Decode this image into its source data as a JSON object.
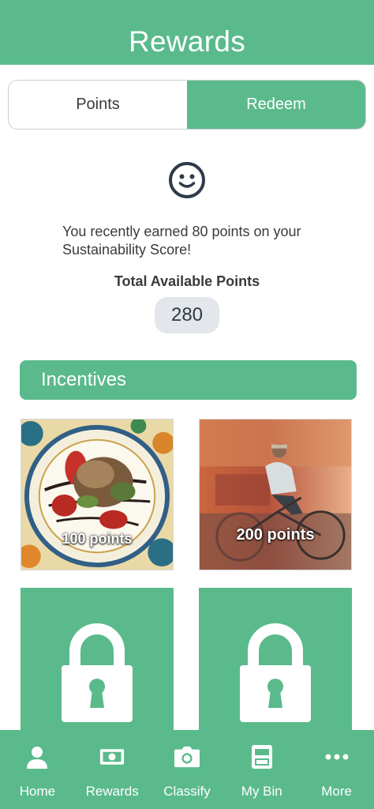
{
  "header": {
    "title": "Rewards"
  },
  "tabs": [
    {
      "label": "Points",
      "selected": false
    },
    {
      "label": "Redeem",
      "selected": true
    }
  ],
  "status_icon": "smiley-face-icon",
  "message": "You recently earned 80 points on your Sustainability Score!",
  "total": {
    "label": "Total Available Points",
    "value": "280"
  },
  "incentives": {
    "title": "Incentives",
    "cards": [
      {
        "label": "100 points",
        "image": "plated-food-photo",
        "locked": false
      },
      {
        "label": "200 points",
        "image": "cyclist-photo",
        "locked": false
      },
      {
        "label": "",
        "image": "lock-icon",
        "locked": true
      },
      {
        "label": "",
        "image": "lock-icon",
        "locked": true
      }
    ]
  },
  "bottom_nav": [
    {
      "label": "Home",
      "icon": "person-icon"
    },
    {
      "label": "Rewards",
      "icon": "cash-icon"
    },
    {
      "label": "Classify",
      "icon": "camera-icon"
    },
    {
      "label": "My Bin",
      "icon": "bin-icon"
    },
    {
      "label": "More",
      "icon": "more-dots-icon"
    }
  ],
  "colors": {
    "accent": "#5aba8c",
    "pill": "#e3e6ea",
    "icon_dark": "#2f3a4a"
  }
}
